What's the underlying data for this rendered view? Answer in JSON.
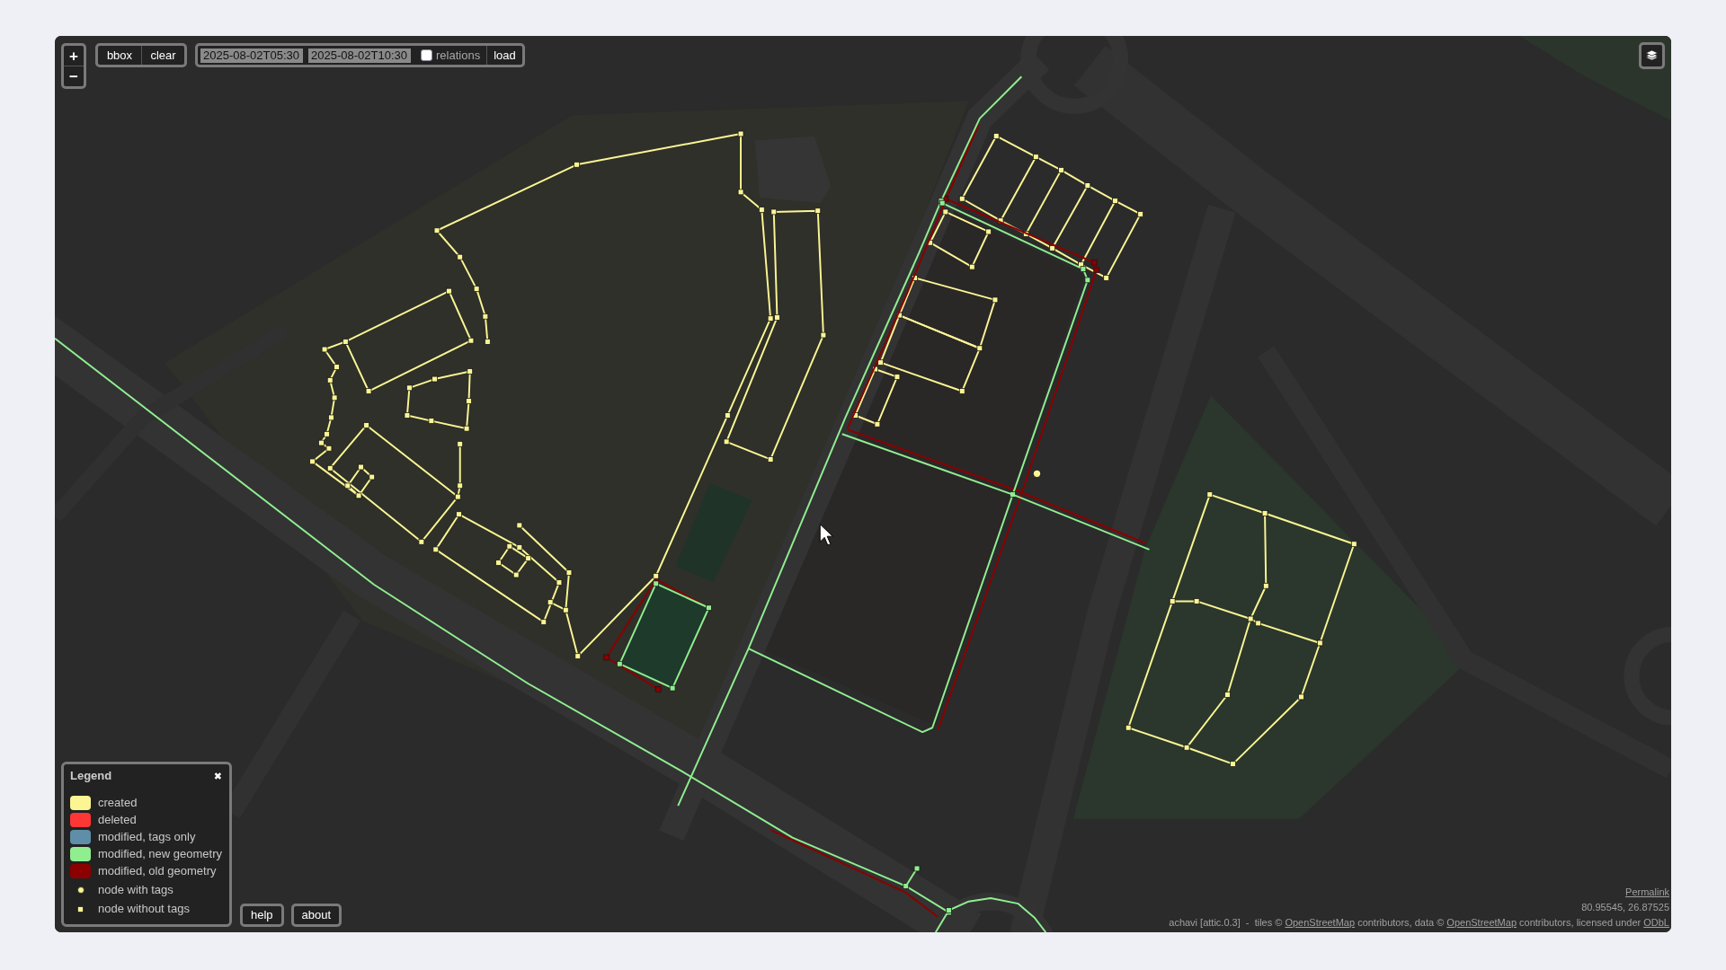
{
  "zoom": {
    "zoom_in": "+",
    "zoom_out": "−"
  },
  "area_buttons": [
    "bbox",
    "clear"
  ],
  "time_filter": {
    "from": "2025-08-02T05:30",
    "to": "2025-08-02T10:30",
    "relations": {
      "label": "relations",
      "checked": false
    },
    "load": "load"
  },
  "legend": {
    "title": "Legend",
    "close": "✖",
    "items": [
      {
        "kind": "swatch",
        "label": "created",
        "color": "#fbf594"
      },
      {
        "kind": "swatch",
        "label": "deleted",
        "color": "#ff3636"
      },
      {
        "kind": "swatch",
        "label": "modified, tags only",
        "color": "#5f8ea8"
      },
      {
        "kind": "swatch",
        "label": "modified, new geometry",
        "color": "#90ee90"
      },
      {
        "kind": "swatch",
        "label": "modified, old geometry",
        "color": "#8b0000"
      },
      {
        "kind": "tagged-node",
        "label": "node with tags"
      },
      {
        "kind": "untagged-node",
        "label": "node without tags"
      }
    ]
  },
  "buttons": [
    "help",
    "about"
  ],
  "permalink": "Permalink",
  "coordinates": "80.95545, 26.87525",
  "attribution": [
    {
      "kind": "text",
      "text": "achavi [attic.0.3]  -  tiles © "
    },
    {
      "kind": "link",
      "text": "OpenStreetMap"
    },
    {
      "kind": "text",
      "text": " contributors, data © "
    },
    {
      "kind": "link",
      "text": "OpenStreetMap"
    },
    {
      "kind": "text",
      "text": " contributors, licensed under "
    },
    {
      "kind": "link",
      "text": "ODbL"
    }
  ]
}
